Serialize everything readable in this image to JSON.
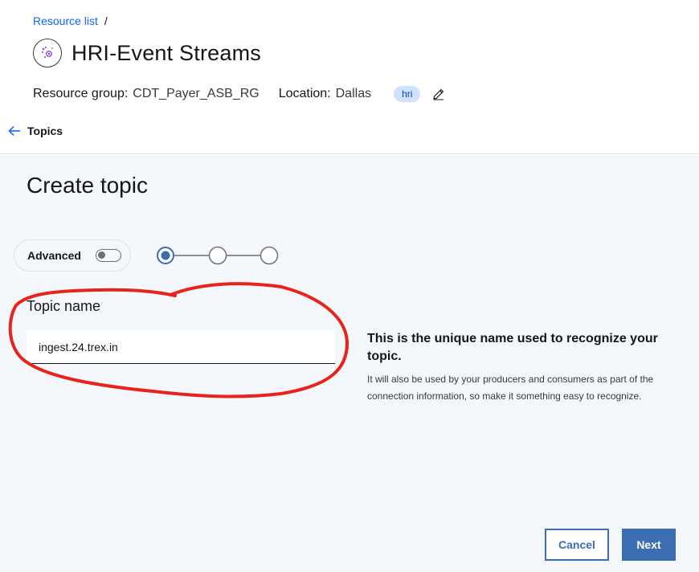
{
  "breadcrumb": {
    "link": "Resource list",
    "separator": "/"
  },
  "service": {
    "title": "HRI-Event Streams",
    "icon": "event-streams-icon"
  },
  "meta": {
    "resource_group_label": "Resource group:",
    "resource_group_value": "CDT_Payer_ASB_RG",
    "location_label": "Location:",
    "location_value": "Dallas",
    "tag": "hri"
  },
  "back": {
    "label": "Topics"
  },
  "page": {
    "title": "Create topic"
  },
  "advanced": {
    "label": "Advanced",
    "enabled": false
  },
  "stepper": {
    "steps": 3,
    "current": 1
  },
  "topic": {
    "label": "Topic name",
    "value": "ingest.24.trex.in"
  },
  "help": {
    "title": "This is the unique name used to recognize your topic.",
    "text": "It will also be used by your producers and consumers as part of the connection information, so make it something easy to recognize."
  },
  "buttons": {
    "cancel": "Cancel",
    "next": "Next"
  },
  "colors": {
    "primary": "#3b6db3",
    "link": "#0f62fe",
    "annotation": "#e8241a",
    "tag_bg": "#d0e2ff"
  }
}
